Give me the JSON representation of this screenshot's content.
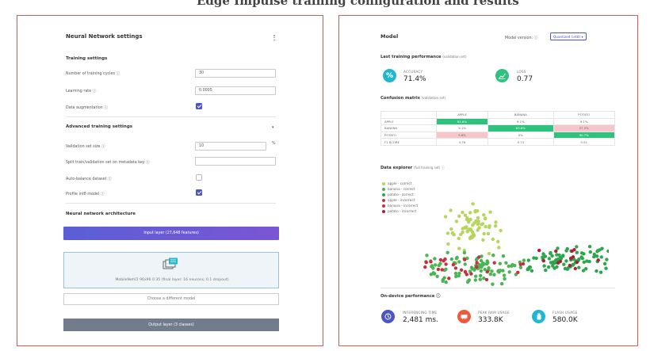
{
  "top_caption": "Edge Impulse training configuration and results",
  "left": {
    "title": "Neural Network settings",
    "training_section": "Training settings",
    "cycles": {
      "label": "Number of training cycles ⓘ",
      "value": "30"
    },
    "learning_rate": {
      "label": "Learning rate ⓘ",
      "value": "0.0005"
    },
    "augmentation": {
      "label": "Data augmentation ⓘ",
      "checked": true
    },
    "advanced_section": "Advanced training settings",
    "validation": {
      "label": "Validation set size ⓘ",
      "value": "10",
      "unit": "%"
    },
    "split_key": {
      "label": "Split train/validation set on metadata key ⓘ",
      "value": ""
    },
    "auto_balance": {
      "label": "Auto-balance dataset ⓘ",
      "checked": false
    },
    "profile_int8": {
      "label": "Profile int8 model ⓘ",
      "checked": true
    },
    "architecture_section": "Neural network architecture",
    "input_layer": "Input layer (27,648 features)",
    "model_name": "MobileNetV2 96x96 0.35 (final layer: 16 neurons, 0.1 dropout)",
    "choose_model": "Choose a different model",
    "output_layer": "Output layer (3 classes)"
  },
  "right": {
    "title": "Model",
    "version_label": "Model version: ⓘ",
    "version_value": "Quantized (int8)",
    "last_perf": "Last training performance",
    "last_perf_sub": "(validation set)",
    "accuracy_label": "ACCURACY",
    "accuracy_value": "71.4%",
    "loss_label": "LOSS",
    "loss_value": "0.77",
    "confusion_title": "Confusion matrix",
    "confusion_sub": "(validation set)",
    "confusion": {
      "columns": [
        "APPLE",
        "BANANA",
        "POTATO"
      ],
      "rows": [
        {
          "label": "APPLE",
          "cells": [
            "81.8%",
            "9.1%",
            "9.1%"
          ]
        },
        {
          "label": "BANANA",
          "cells": [
            "9.1%",
            "63.6%",
            "27.3%"
          ]
        },
        {
          "label": "POTATO",
          "cells": [
            "5.6%",
            "0%",
            "90.7%"
          ]
        },
        {
          "label": "F1 SCORE",
          "cells": [
            "0.76",
            "0.74",
            "0.51"
          ]
        }
      ]
    },
    "explorer_title": "Data explorer",
    "explorer_sub": "(full training set) ⓘ",
    "legend": [
      {
        "label": "apple - correct",
        "color": "#b5d55c"
      },
      {
        "label": "banana - correct",
        "color": "#4ab552"
      },
      {
        "label": "potato - correct",
        "color": "#2ca74b"
      },
      {
        "label": "apple - incorrect",
        "color": "#c23248"
      },
      {
        "label": "banana - incorrect",
        "color": "#d22b3c"
      },
      {
        "label": "potato - incorrect",
        "color": "#a8203a"
      }
    ],
    "ondevice_title": "On-device performance ⓘ",
    "inference_label": "INFERENCING TIME",
    "inference_value": "2,481 ms.",
    "ram_label": "PEAK RAM USAGE",
    "ram_value": "333.8K",
    "flash_label": "FLASH USAGE",
    "flash_value": "580.0K"
  },
  "colors": {
    "accent": "#4b55c8",
    "teal": "#1fb8d0",
    "green": "#2ec27e",
    "orange": "#f05a3c",
    "cm_green": "#2ec27e",
    "cm_pink": "#f6c6cb",
    "frame": "#d95a55"
  }
}
